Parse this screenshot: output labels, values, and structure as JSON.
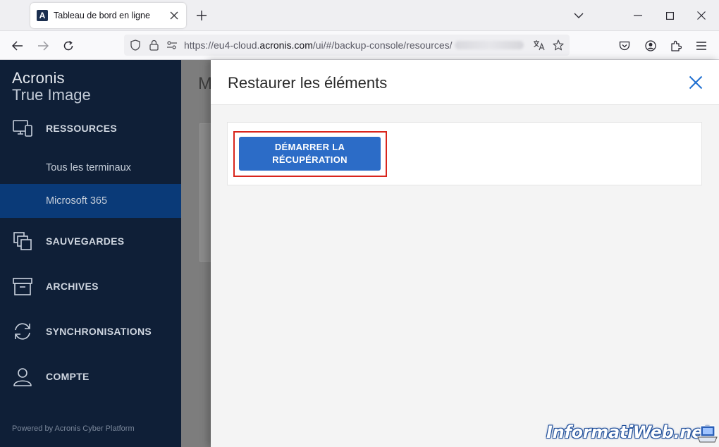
{
  "browser": {
    "tab": {
      "title": "Tableau de bord en ligne",
      "favicon_letter": "A"
    },
    "url": {
      "prefix": "https://eu4-cloud.",
      "domain": "acronis.com",
      "path": "/ui/#/backup-console/resources/"
    }
  },
  "sidebar": {
    "brand_line1": "Acronis",
    "brand_line2": "True Image",
    "sections": [
      {
        "label": "RESSOURCES",
        "icon": "devices-icon"
      },
      {
        "label": "SAUVEGARDES",
        "icon": "copies-icon"
      },
      {
        "label": "ARCHIVES",
        "icon": "archive-box-icon"
      },
      {
        "label": "SYNCHRONISATIONS",
        "icon": "sync-icon"
      },
      {
        "label": "COMPTE",
        "icon": "user-icon"
      }
    ],
    "subitems": [
      {
        "label": "Tous les terminaux",
        "active": false
      },
      {
        "label": "Microsoft 365",
        "active": true
      }
    ],
    "footer": "Powered by Acronis Cyber Platform"
  },
  "main": {
    "title_partial": "M"
  },
  "panel": {
    "title": "Restaurer les éléments",
    "primary_button": "DÉMARRER LA RÉCUPÉRATION"
  },
  "watermark": {
    "text": "InformatiWeb.net"
  },
  "colors": {
    "sidebar_bg": "#0f1f37",
    "sidebar_active": "#0a3a78",
    "primary": "#2c6cc7",
    "highlight": "#d9251c",
    "close_icon": "#1f6fd0"
  }
}
